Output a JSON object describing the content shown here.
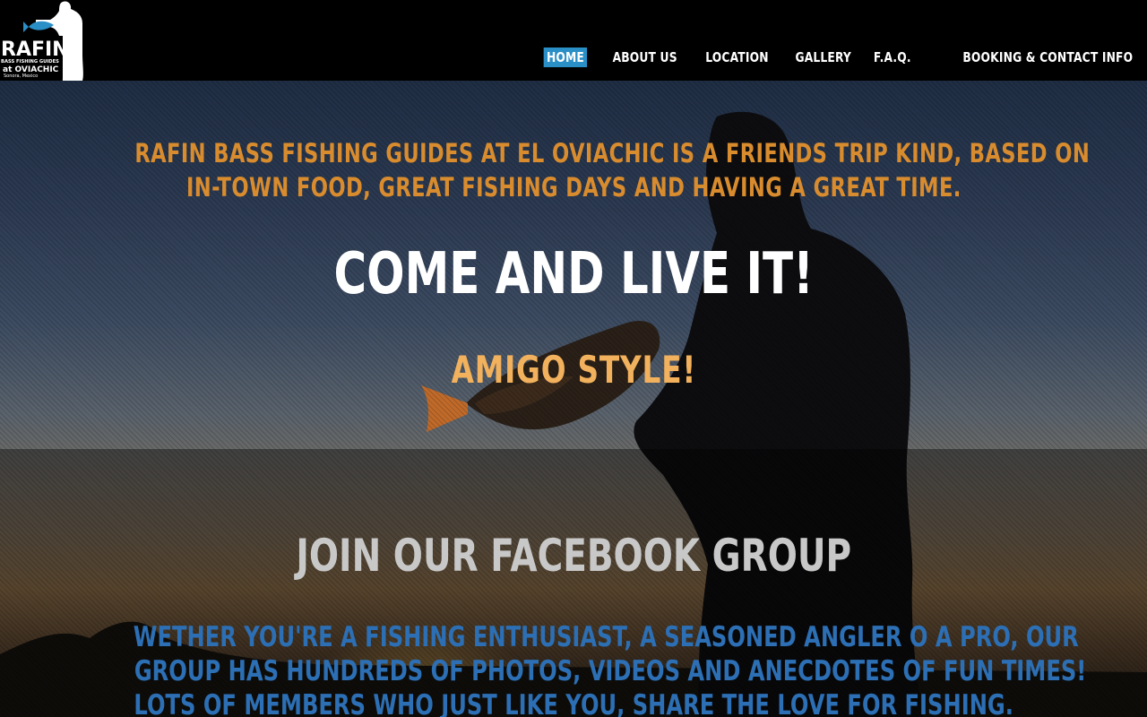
{
  "logo": {
    "name": "RAFIN",
    "line1": "BASS FISHING GUIDES",
    "line2": "at OVIACHIC",
    "line3": "Sonora, Mexico",
    "icon": "fisherman-logo-icon"
  },
  "nav": {
    "items": [
      {
        "label": "HOME",
        "active": true
      },
      {
        "label": "ABOUT US",
        "active": false
      },
      {
        "label": "LOCATION",
        "active": false
      },
      {
        "label": "GALLERY",
        "active": false
      },
      {
        "label": "F.A.Q.",
        "active": false
      },
      {
        "label": "BOOKING & CONTACT INFO",
        "active": false
      }
    ],
    "active_color": "#2a8fc6"
  },
  "hero": {
    "intro_line1": "RAFIN BASS FISHING GUIDES AT EL OVIACHIC IS A FRIENDS TRIP KIND, BASED ON",
    "intro_line2": "IN-TOWN FOOD, GREAT FISHING DAYS AND HAVING A GREAT TIME.",
    "headline": "COME AND LIVE IT!",
    "subheadline": "AMIGO STYLE!",
    "intro_color": "#d98c2e",
    "subheadline_color": "#f2b15c"
  },
  "facebook": {
    "title": "JOIN OUR FACEBOOK GROUP",
    "text_line1": "WETHER YOU'RE A FISHING ENTHUSIAST, A SEASONED ANGLER O A PRO, OUR",
    "text_line2": "GROUP HAS HUNDREDS OF PHOTOS, VIDEOS AND ANECDOTES OF FUN TIMES!",
    "text_line3": "LOTS OF MEMBERS WHO JUST LIKE YOU, SHARE THE LOVE FOR FISHING.",
    "text_color": "#2c6fb4"
  }
}
